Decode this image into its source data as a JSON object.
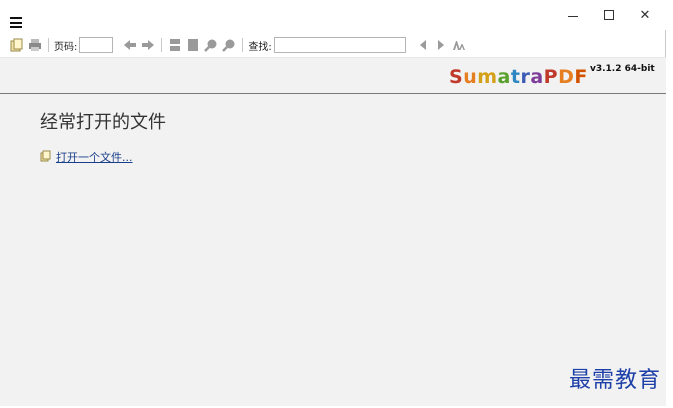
{
  "window": {
    "controls": {
      "minimize": "–",
      "maximize": "☐",
      "close": "✕"
    }
  },
  "toolbar": {
    "page_label": "页码:",
    "page_value": "",
    "find_label": "查找:",
    "find_value": ""
  },
  "brand": {
    "name_letters": [
      "S",
      "u",
      "m",
      "a",
      "t",
      "r",
      "a",
      "P",
      "D",
      "F"
    ],
    "name_colors": [
      "#c0392b",
      "#e67e22",
      "#d4a017",
      "#5aa02c",
      "#2e86c1",
      "#3b5bb5",
      "#7d3c98",
      "#c0392b",
      "#e67e22",
      "#d35400"
    ],
    "version": "v3.1.2 64-bit"
  },
  "main": {
    "heading": "经常打开的文件",
    "open_file_link": "打开一个文件..."
  },
  "watermark": "最需教育",
  "colors": {
    "content_bg": "#f2f2f2",
    "link": "#1a3f8a",
    "watermark": "#1c3fa8"
  }
}
